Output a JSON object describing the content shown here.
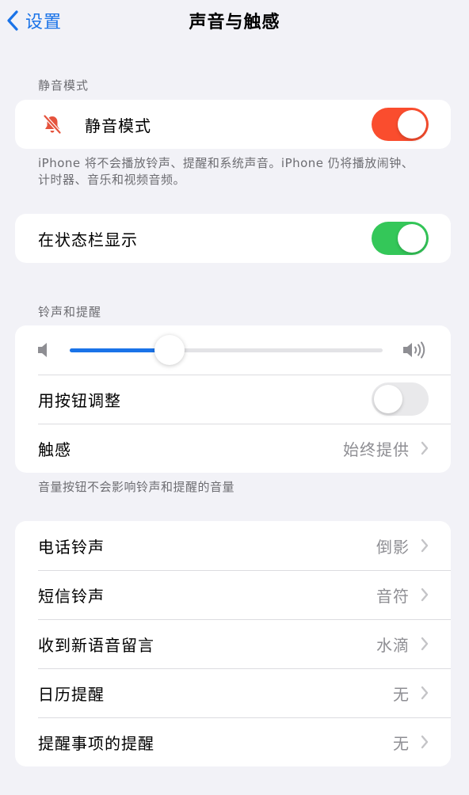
{
  "nav": {
    "back_label": "设置",
    "title": "声音与触感"
  },
  "silent_section": {
    "header": "静音模式",
    "row_label": "静音模式",
    "icon": "bell-slash-icon",
    "toggle_on": true,
    "toggle_color": "#fa4d2e",
    "footer": "iPhone 将不会播放铃声、提醒和系统声音。iPhone 仍将播放闹钟、计时器、音乐和视频音频。"
  },
  "status_bar_section": {
    "row_label": "在状态栏显示",
    "toggle_on": true,
    "toggle_color": "#34c759"
  },
  "ringer_section": {
    "header": "铃声和提醒",
    "volume_level": 0.32,
    "volume_low_icon": "speaker-low-icon",
    "volume_high_icon": "speaker-high-icon",
    "adjust_label": "用按钮调整",
    "adjust_toggle_on": false,
    "haptics_label": "触感",
    "haptics_value": "始终提供",
    "footer": "音量按钮不会影响铃声和提醒的音量"
  },
  "sounds_section": {
    "items": [
      {
        "label": "电话铃声",
        "value": "倒影"
      },
      {
        "label": "短信铃声",
        "value": "音符"
      },
      {
        "label": "收到新语音留言",
        "value": "水滴"
      },
      {
        "label": "日历提醒",
        "value": "无"
      },
      {
        "label": "提醒事项的提醒",
        "value": "无"
      }
    ]
  },
  "colors": {
    "accent": "#1a73e8",
    "toggle_off": "#e9e9eb",
    "chevron": "#c4c4c7"
  }
}
